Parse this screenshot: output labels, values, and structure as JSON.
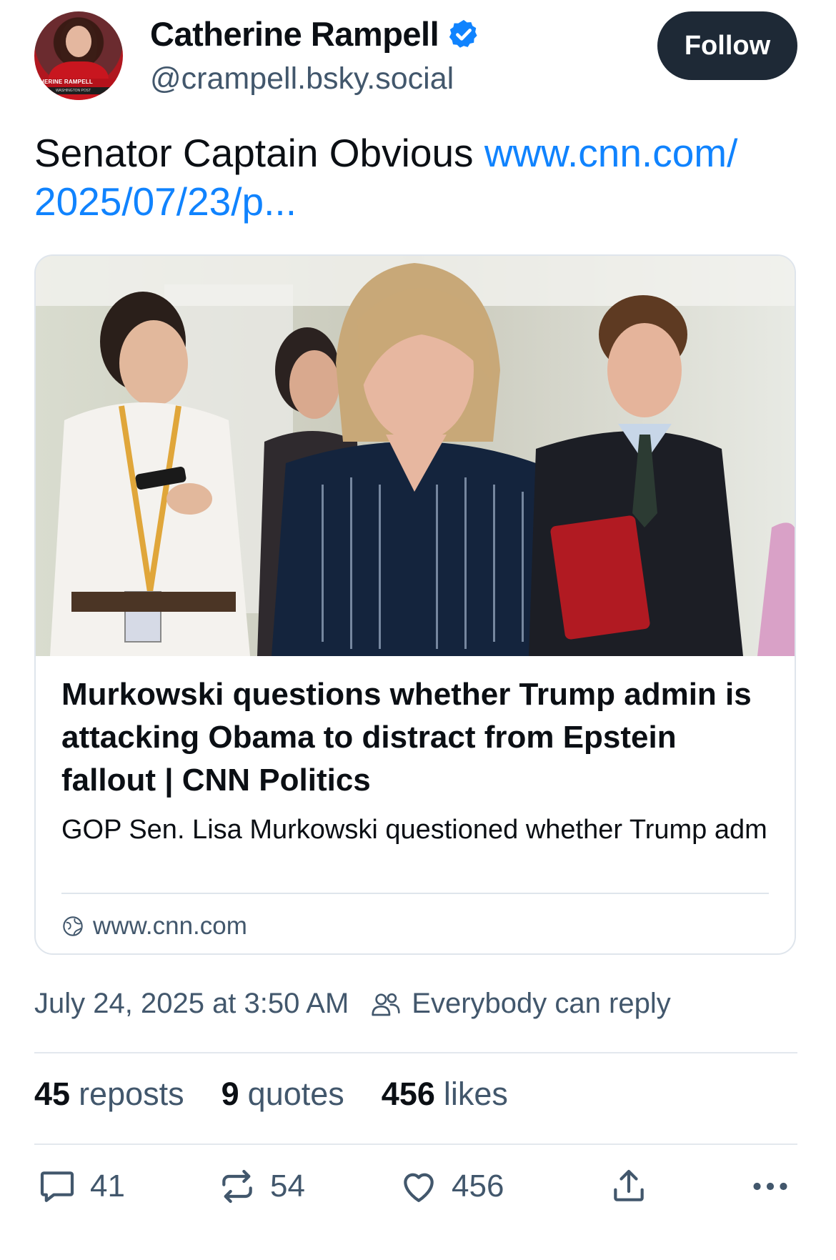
{
  "author": {
    "name": "Catherine Rampell",
    "handle": "@crampell.bsky.social",
    "avatar_banner": "HERINE RAMPELL",
    "avatar_banner_sub": "WASHINGTON POST",
    "verified": true
  },
  "follow_label": "Follow",
  "post": {
    "text": "Senator Captain Obvious ",
    "link": "www.cnn.com/ 2025/07/23/p..."
  },
  "card": {
    "title": "Murkowski questions whether Trump admin is attacking Obama to distract from Epstein fallout | CNN Politics",
    "description": "GOP Sen. Lisa Murkowski questioned whether Trump administration officials are accusing former Preside...",
    "domain": "www.cnn.com"
  },
  "meta": {
    "timestamp": "July 24, 2025 at 3:50 AM",
    "reply_setting": "Everybody can reply"
  },
  "stats": {
    "reposts_count": "45",
    "reposts_label": "reposts",
    "quotes_count": "9",
    "quotes_label": "quotes",
    "likes_count": "456",
    "likes_label": "likes"
  },
  "actions": {
    "reply_count": "41",
    "repost_count": "54",
    "like_count": "456"
  },
  "colors": {
    "link": "#1083fe",
    "follow_bg": "#1e2936",
    "muted": "#42576c"
  }
}
